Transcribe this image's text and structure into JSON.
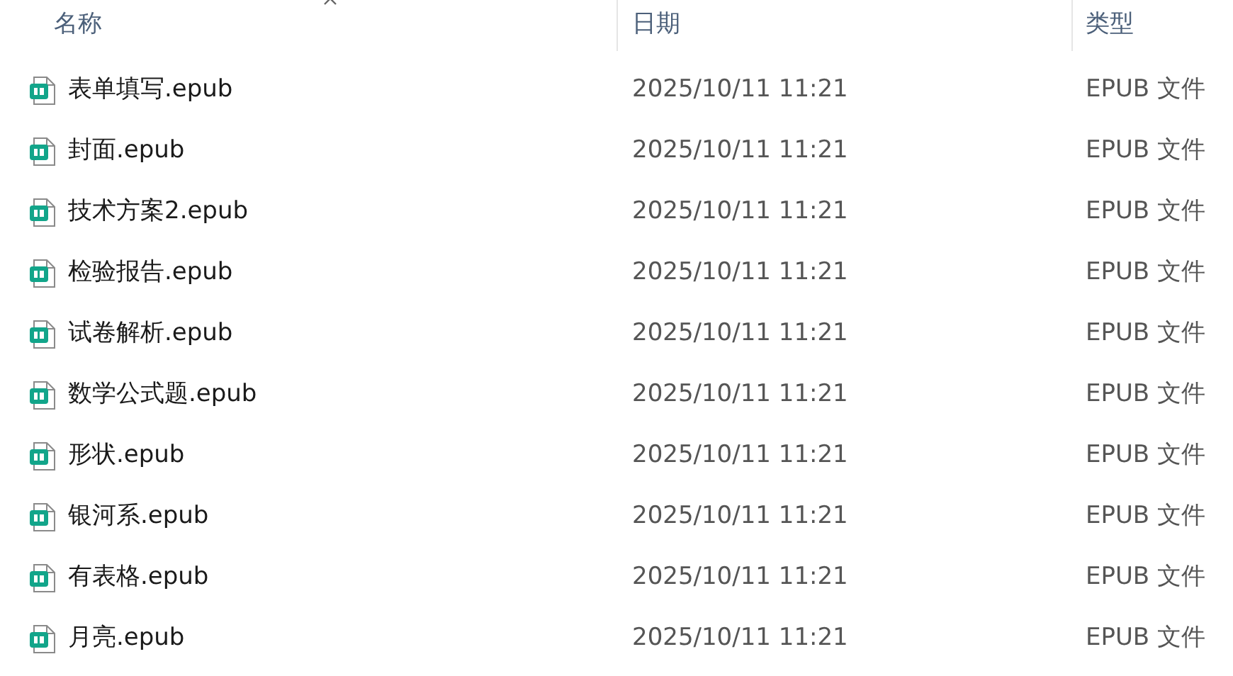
{
  "columns": [
    {
      "label": "名称",
      "sorted": true
    },
    {
      "label": "日期",
      "sorted": false
    },
    {
      "label": "类型",
      "sorted": false
    }
  ],
  "rows": [
    {
      "name": "表单填写.epub",
      "date": "2025/10/11 11:21",
      "type": "EPUB 文件"
    },
    {
      "name": "封面.epub",
      "date": "2025/10/11 11:21",
      "type": "EPUB 文件"
    },
    {
      "name": "技术方案2.epub",
      "date": "2025/10/11 11:21",
      "type": "EPUB 文件"
    },
    {
      "name": "检验报告.epub",
      "date": "2025/10/11 11:21",
      "type": "EPUB 文件"
    },
    {
      "name": "试卷解析.epub",
      "date": "2025/10/11 11:21",
      "type": "EPUB 文件"
    },
    {
      "name": "数学公式题.epub",
      "date": "2025/10/11 11:21",
      "type": "EPUB 文件"
    },
    {
      "name": "形状.epub",
      "date": "2025/10/11 11:21",
      "type": "EPUB 文件"
    },
    {
      "name": "银河系.epub",
      "date": "2025/10/11 11:21",
      "type": "EPUB 文件"
    },
    {
      "name": "有表格.epub",
      "date": "2025/10/11 11:21",
      "type": "EPUB 文件"
    },
    {
      "name": "月亮.epub",
      "date": "2025/10/11 11:21",
      "type": "EPUB 文件"
    }
  ]
}
